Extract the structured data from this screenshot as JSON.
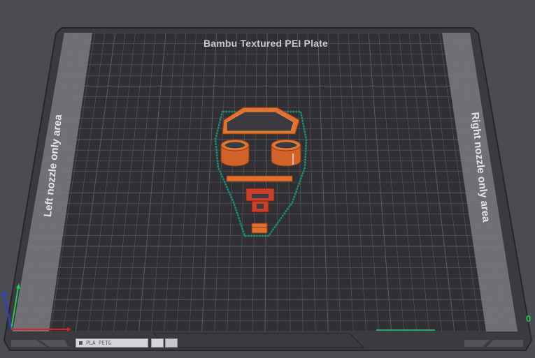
{
  "plate": {
    "title": "Bambu Textured PEI Plate",
    "left_area_label": "Left nozzle only area",
    "right_area_label": "Right nozzle only area",
    "tag_text": "PLA PETG"
  },
  "colors": {
    "background": "#4b4b52",
    "plate_bed": "#2f2f34",
    "grid_line": "#5a5a60",
    "side_area": "#7a7a80",
    "model_orange": "#e2712d",
    "model_red": "#c8402a",
    "boundary_green": "#1a8f6a",
    "axis_x": "#e0202a",
    "axis_y": "#22cc55",
    "axis_z": "#2a3fd6"
  },
  "objects": [
    "plate-top-object",
    "left-cylinder",
    "right-cylinder",
    "flat-bar",
    "red-clip",
    "small-block"
  ],
  "axis": {
    "side_label": "0"
  },
  "icons": [
    "plate-icon"
  ]
}
